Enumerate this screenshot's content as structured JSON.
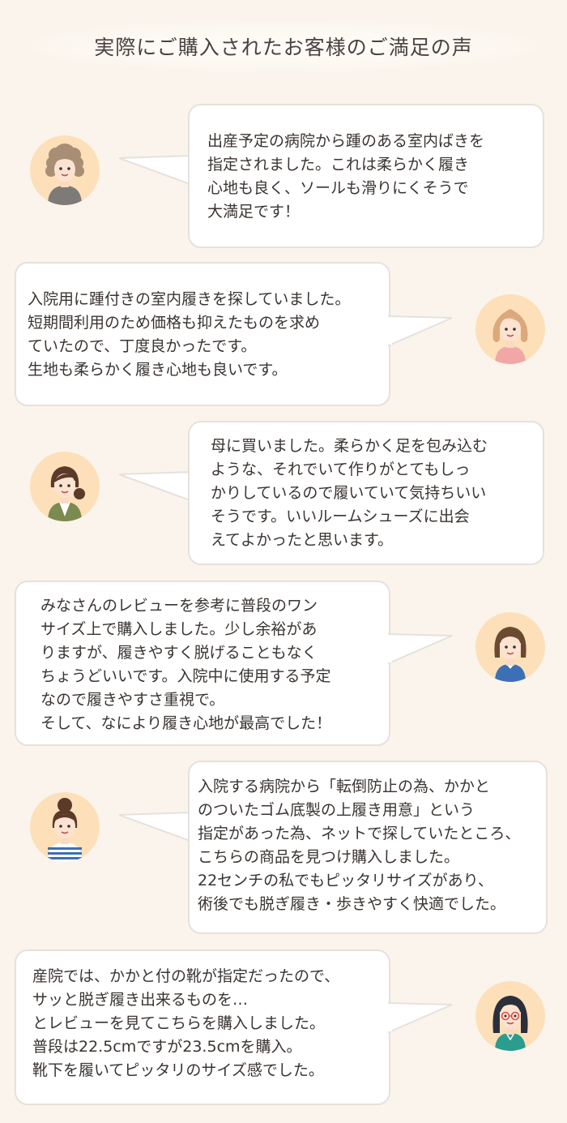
{
  "title": "実際にご購入されたお客様のご満足の声",
  "colors": {
    "background": "#faf4ec",
    "bubble": "#ffffff",
    "bubble_border": "#e6e1dc",
    "avatar_bg": "#fde0b9"
  },
  "reviews": [
    {
      "avatar": "curly-hair-woman-avatar",
      "text": "出産予定の病院から踵のある室内ばきを\n指定されました。これは柔らかく履き\n心地も良く、ソールも滑りにくそうで\n大満足です！"
    },
    {
      "avatar": "wavy-hair-woman-avatar",
      "text": "入院用に踵付きの室内履きを探していました。\n短期間利用のため価格も抑えたものを求め\nていたので、丁度良かったです。\n生地も柔らかく履き心地も良いです。"
    },
    {
      "avatar": "side-ponytail-woman-avatar",
      "text": "母に買いました。柔らかく足を包み込む\nような、それでいて作りがとてもしっ\nかりしているので履いていて気持ちいい\nそうです。いいルームシューズに出会\nえてよかったと思います。"
    },
    {
      "avatar": "bob-hair-woman-avatar",
      "text": "みなさんのレビューを参考に普段のワン\nサイズ上で購入しました。少し余裕があ\nりますが、履きやすく脱げることもなく\nちょうどいいです。入院中に使用する予定\nなので履きやすさ重視で。\nそして、なにより履き心地が最高でした！"
    },
    {
      "avatar": "bun-hair-woman-avatar",
      "text": "入院する病院から「転倒防止の為、かかと\nのついたゴム底製の上履き用意」という\n指定があった為、ネットで探していたところ、\nこちらの商品を見つけ購入しました。\n22センチの私でもピッタリサイズがあり、\n術後でも脱ぎ履き・歩きやすく快適でした。"
    },
    {
      "avatar": "glasses-woman-avatar",
      "text": "産院では、かかと付の靴が指定だったので、\nサッと脱ぎ履き出来るものを…\nとレビューを見てこちらを購入しました。\n普段は22.5cmですが23.5cmを購入。\n靴下を履いてピッタリのサイズ感でした。"
    }
  ]
}
